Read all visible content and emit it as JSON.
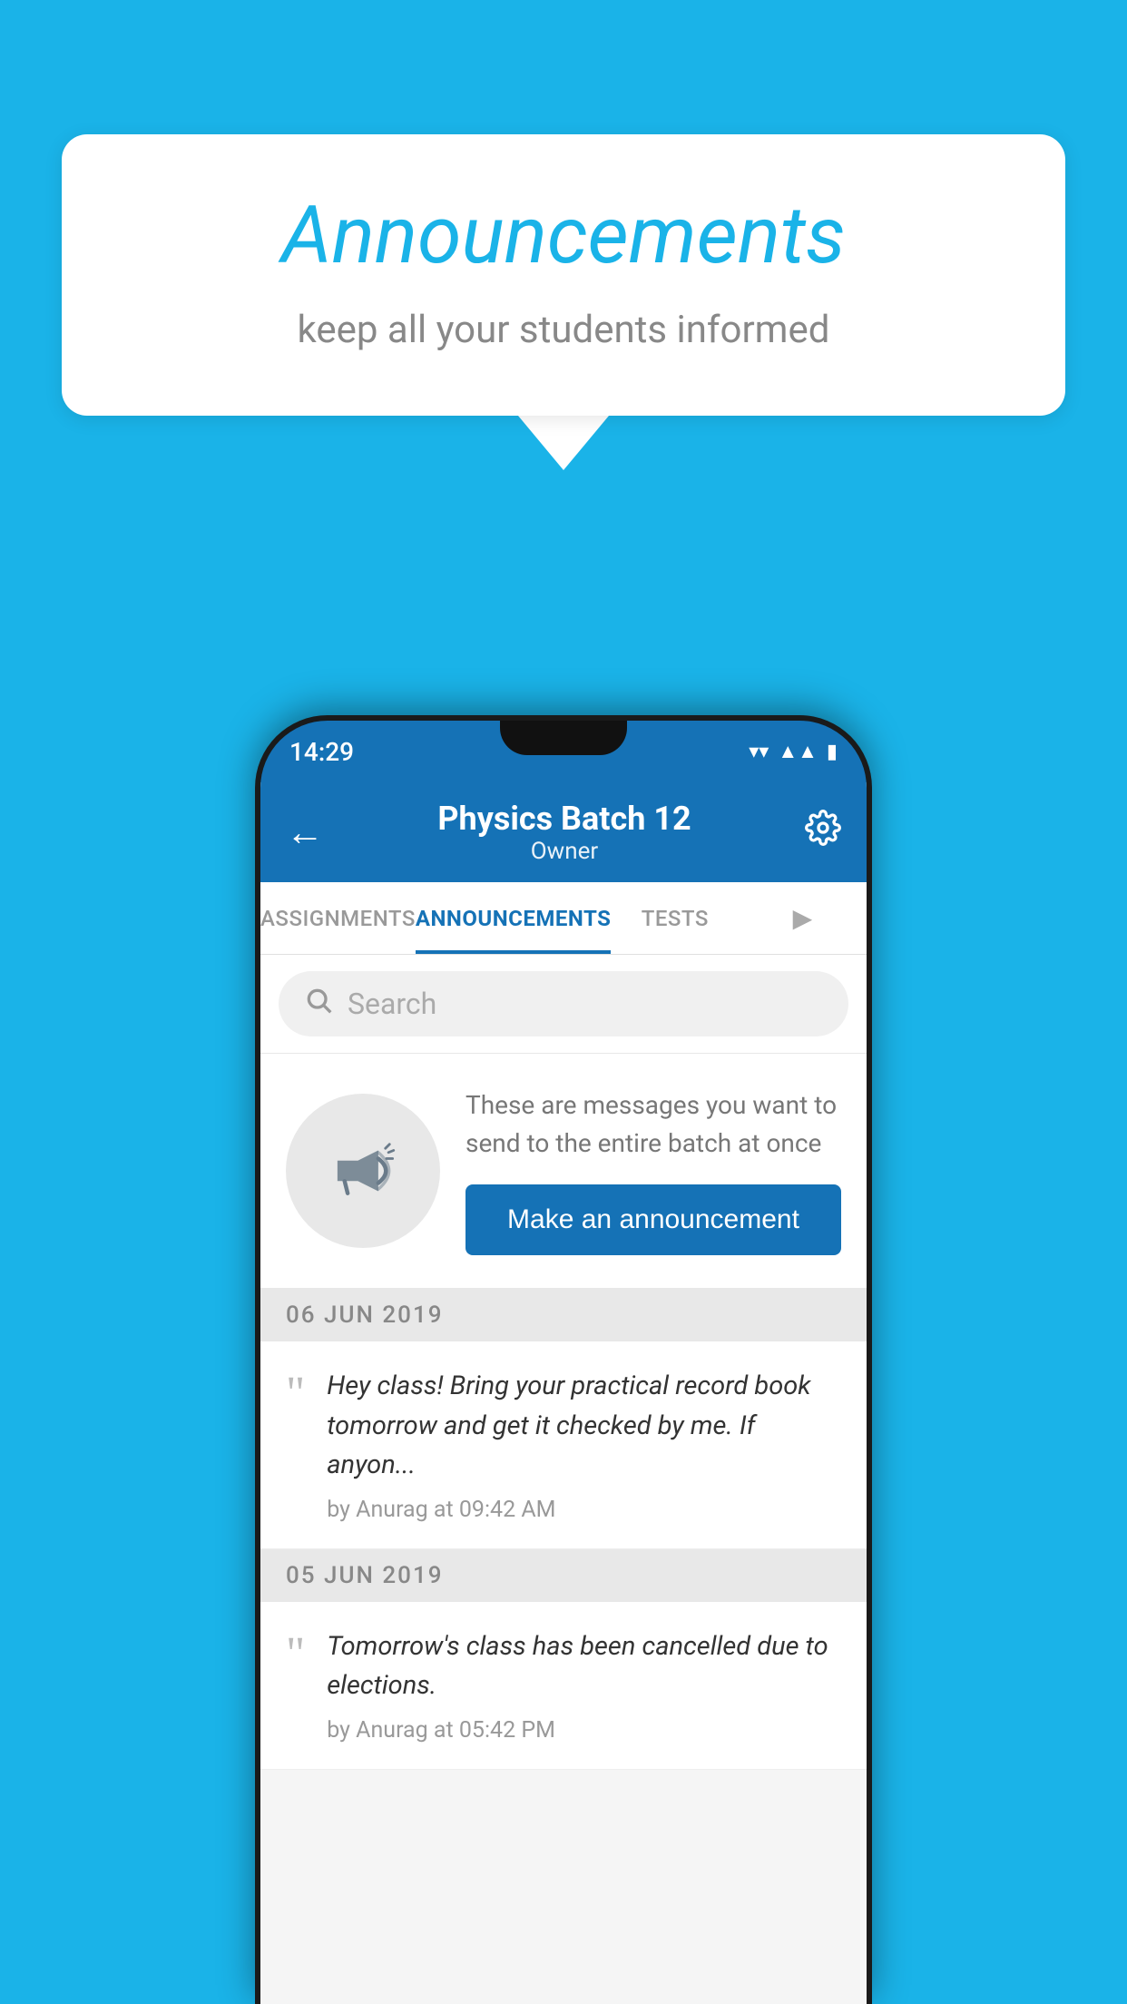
{
  "background_color": "#1ab3e8",
  "speech_bubble": {
    "title": "Announcements",
    "subtitle": "keep all your students informed"
  },
  "phone": {
    "status_bar": {
      "time": "14:29",
      "icons": [
        "wifi",
        "signal",
        "battery"
      ]
    },
    "app_bar": {
      "title": "Physics Batch 12",
      "subtitle": "Owner",
      "back_label": "←",
      "settings_label": "⚙"
    },
    "tabs": [
      {
        "label": "ASSIGNMENTS",
        "active": false
      },
      {
        "label": "ANNOUNCEMENTS",
        "active": true
      },
      {
        "label": "TESTS",
        "active": false
      },
      {
        "label": "...",
        "active": false
      }
    ],
    "search": {
      "placeholder": "Search"
    },
    "promo": {
      "description": "These are messages you want to send to the entire batch at once",
      "button_label": "Make an announcement"
    },
    "announcements": [
      {
        "date": "06  JUN  2019",
        "text": "Hey class! Bring your practical record book tomorrow and get it checked by me. If anyon...",
        "meta": "by Anurag at 09:42 AM"
      },
      {
        "date": "05  JUN  2019",
        "text": "Tomorrow's class has been cancelled due to elections.",
        "meta": "by Anurag at 05:42 PM"
      }
    ]
  }
}
